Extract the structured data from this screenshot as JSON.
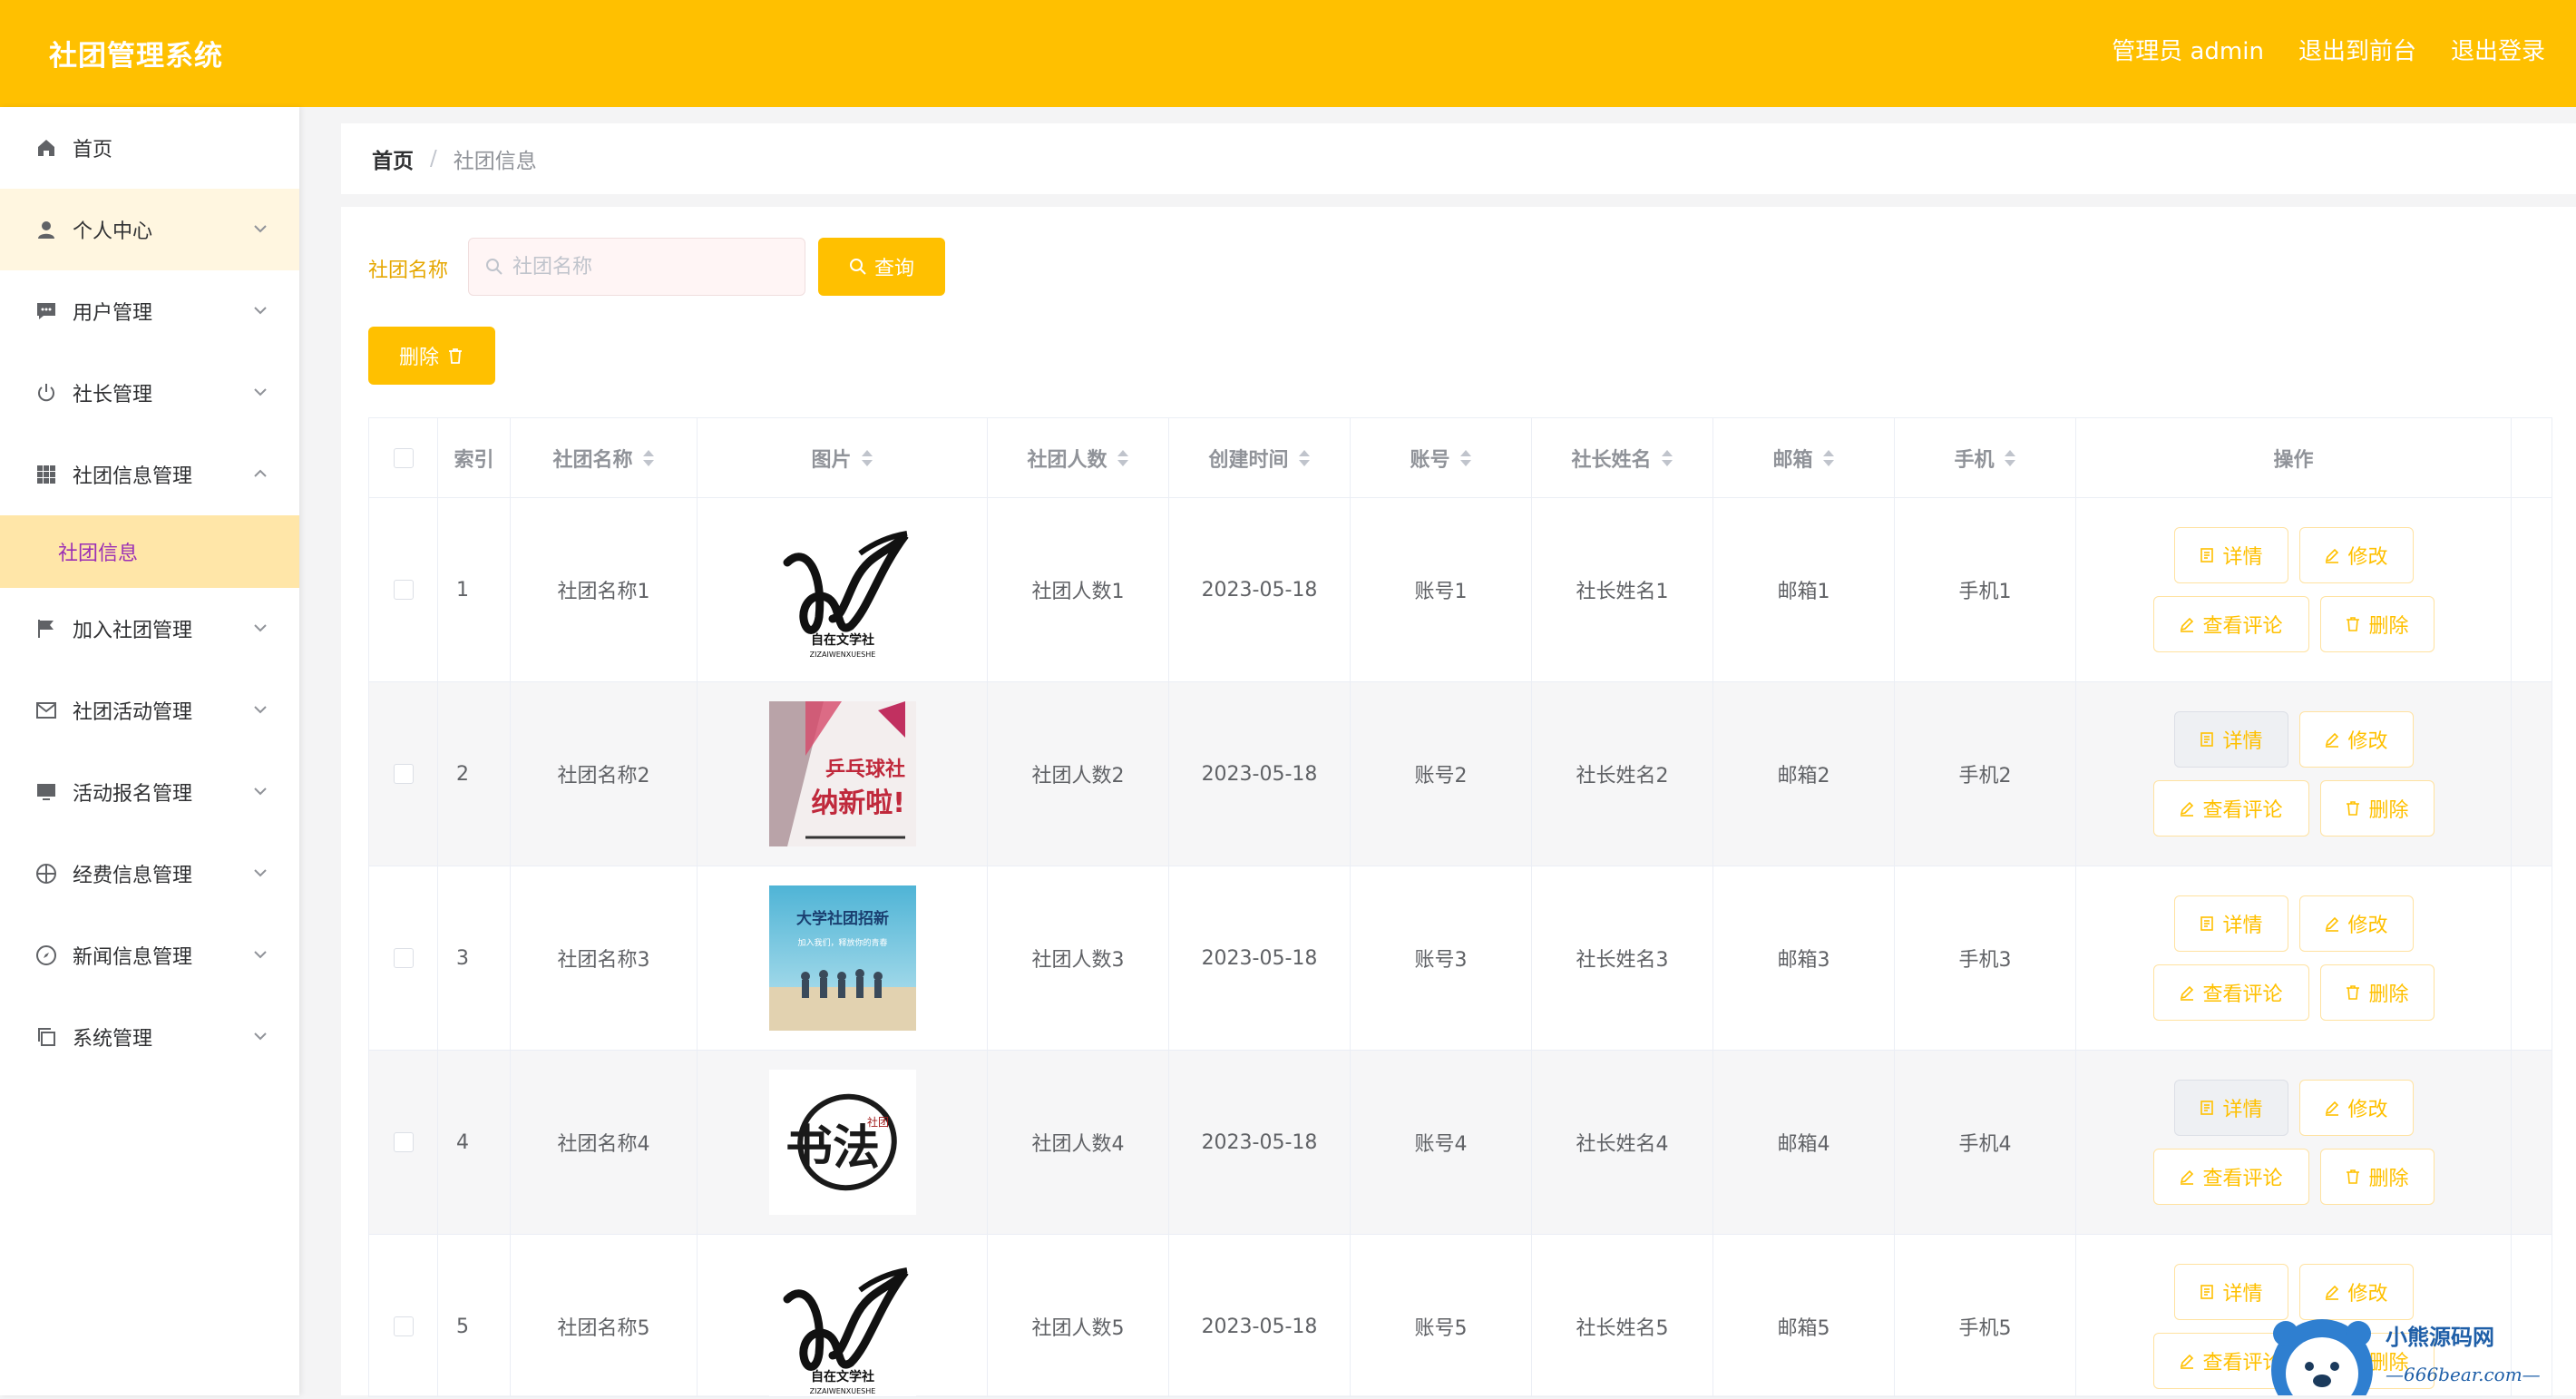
{
  "header": {
    "title": "社团管理系统",
    "admin": "管理员 admin",
    "front": "退出到前台",
    "logout": "退出登录"
  },
  "sidebar": {
    "items": [
      {
        "label": "首页",
        "icon": "home-icon"
      },
      {
        "label": "个人中心",
        "icon": "user-icon"
      },
      {
        "label": "用户管理",
        "icon": "chat-icon"
      },
      {
        "label": "社长管理",
        "icon": "power-icon"
      },
      {
        "label": "社团信息管理",
        "icon": "grid-icon"
      },
      {
        "label": "加入社团管理",
        "icon": "flag-icon"
      },
      {
        "label": "社团活动管理",
        "icon": "mail-icon"
      },
      {
        "label": "活动报名管理",
        "icon": "monitor-icon"
      },
      {
        "label": "经费信息管理",
        "icon": "aperture-icon"
      },
      {
        "label": "新闻信息管理",
        "icon": "compass-icon"
      },
      {
        "label": "系统管理",
        "icon": "copy-icon"
      }
    ],
    "sub": "社团信息"
  },
  "breadcrumb": {
    "home": "首页",
    "sep": "/",
    "current": "社团信息"
  },
  "search": {
    "label": "社团名称",
    "placeholder": "社团名称",
    "button": "查询"
  },
  "delete_button": "删除",
  "table": {
    "headers": [
      "索引",
      "社团名称",
      "图片",
      "社团人数",
      "创建时间",
      "账号",
      "社长姓名",
      "邮箱",
      "手机",
      "操作"
    ],
    "rows": [
      {
        "index": "1",
        "name": "社团名称1",
        "image": "logo-1",
        "count": "社团人数1",
        "date": "2023-05-18",
        "account": "账号1",
        "leader": "社长姓名1",
        "email": "邮箱1",
        "phone": "手机1"
      },
      {
        "index": "2",
        "name": "社团名称2",
        "image": "poster-pingpong",
        "count": "社团人数2",
        "date": "2023-05-18",
        "account": "账号2",
        "leader": "社长姓名2",
        "email": "邮箱2",
        "phone": "手机2"
      },
      {
        "index": "3",
        "name": "社团名称3",
        "image": "poster-beach",
        "count": "社团人数3",
        "date": "2023-05-18",
        "account": "账号3",
        "leader": "社长姓名3",
        "email": "邮箱3",
        "phone": "手机3"
      },
      {
        "index": "4",
        "name": "社团名称4",
        "image": "logo-calligraphy",
        "count": "社团人数4",
        "date": "2023-05-18",
        "account": "账号4",
        "leader": "社长姓名4",
        "email": "邮箱4",
        "phone": "手机4"
      },
      {
        "index": "5",
        "name": "社团名称5",
        "image": "logo-1",
        "count": "社团人数5",
        "date": "2023-05-18",
        "account": "账号5",
        "leader": "社长姓名5",
        "email": "邮箱5",
        "phone": "手机5"
      }
    ],
    "actions": {
      "detail": "详情",
      "edit": "修改",
      "comments": "查看评论",
      "delete": "删除"
    }
  },
  "images": {
    "logo1_caption": "自在文学社",
    "logo1_sub": "ZIZAIWENXUESHE",
    "poster2_line1": "乒乓球社",
    "poster2_line2": "纳新啦!",
    "poster3_title": "大学社团招新",
    "poster3_sub": "加入我们，释放你的青春",
    "logo4_text": "书法",
    "logo4_sub": "社团"
  },
  "watermark": {
    "line1": "小熊源码网",
    "line2": "—666bear.com—"
  },
  "colors": {
    "primary": "#ffc000",
    "sub_active_bg": "#ffe6a8",
    "sub_active_text": "#9b2fb5"
  }
}
